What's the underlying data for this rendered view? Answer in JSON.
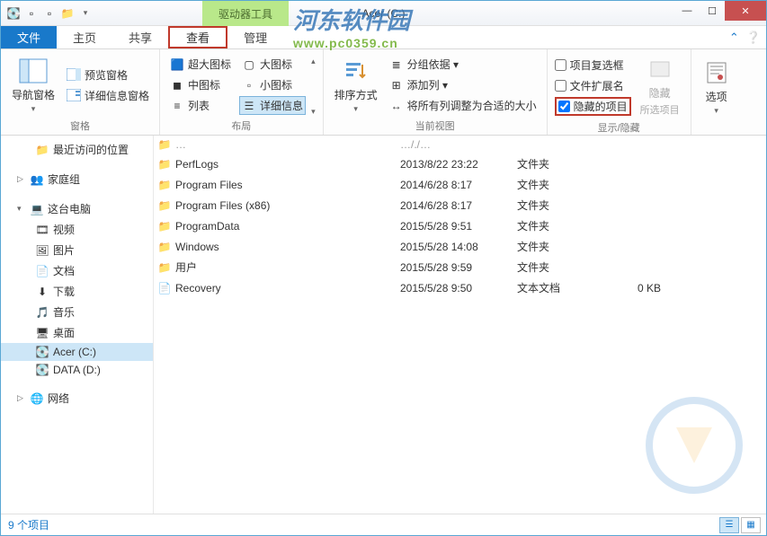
{
  "titlebar": {
    "context_tab": "驱动器工具",
    "title": "Acer (C:)"
  },
  "tabs": {
    "file": "文件",
    "items": [
      "主页",
      "共享",
      "查看",
      "管理"
    ],
    "active_index": 2
  },
  "ribbon": {
    "panes": {
      "nav_pane": "导航窗格",
      "preview_pane": "预览窗格",
      "details_pane": "详细信息窗格",
      "group_label": "窗格"
    },
    "layout": {
      "xl_icons": "超大图标",
      "l_icons": "大图标",
      "m_icons": "中图标",
      "s_icons": "小图标",
      "list": "列表",
      "details": "详细信息",
      "group_label": "布局"
    },
    "currentview": {
      "sort": "排序方式",
      "groupby": "分组依据 ▾",
      "addcol": "添加列 ▾",
      "autosize": "将所有列调整为合适的大小",
      "group_label": "当前视图"
    },
    "showhide": {
      "chk_itemcheckboxes": "项目复选框",
      "chk_extensions": "文件扩展名",
      "chk_hidden": "隐藏的项目",
      "hide_btn": "隐藏",
      "hide_btn_sub": "所选项目",
      "group_label": "显示/隐藏"
    },
    "options": {
      "label": "选项"
    }
  },
  "sidebar": {
    "items": [
      {
        "label": "最近访问的位置",
        "icon": "📁",
        "indent": 1
      },
      {
        "label": "",
        "spacer": true
      },
      {
        "label": "家庭组",
        "icon": "👥",
        "indent": 0,
        "arrow": "▷"
      },
      {
        "label": "",
        "spacer": true
      },
      {
        "label": "这台电脑",
        "icon": "💻",
        "indent": 0,
        "arrow": "▾"
      },
      {
        "label": "视频",
        "icon": "🎞",
        "indent": 1
      },
      {
        "label": "图片",
        "icon": "🖼",
        "indent": 1
      },
      {
        "label": "文档",
        "icon": "📄",
        "indent": 1
      },
      {
        "label": "下载",
        "icon": "⬇",
        "indent": 1
      },
      {
        "label": "音乐",
        "icon": "🎵",
        "indent": 1
      },
      {
        "label": "桌面",
        "icon": "🖥",
        "indent": 1
      },
      {
        "label": "Acer (C:)",
        "icon": "💽",
        "indent": 1,
        "selected": true
      },
      {
        "label": "DATA (D:)",
        "icon": "💽",
        "indent": 1
      },
      {
        "label": "",
        "spacer": true
      },
      {
        "label": "网络",
        "icon": "🌐",
        "indent": 0,
        "arrow": "▷"
      }
    ]
  },
  "files": [
    {
      "name": "PerfLogs",
      "date": "2013/8/22 23:22",
      "type": "文件夹",
      "size": "",
      "icon": "folder"
    },
    {
      "name": "Program Files",
      "date": "2014/6/28 8:17",
      "type": "文件夹",
      "size": "",
      "icon": "folder"
    },
    {
      "name": "Program Files (x86)",
      "date": "2014/6/28 8:17",
      "type": "文件夹",
      "size": "",
      "icon": "folder"
    },
    {
      "name": "ProgramData",
      "date": "2015/5/28 9:51",
      "type": "文件夹",
      "size": "",
      "icon": "folder"
    },
    {
      "name": "Windows",
      "date": "2015/5/28 14:08",
      "type": "文件夹",
      "size": "",
      "icon": "folder"
    },
    {
      "name": "用户",
      "date": "2015/5/28 9:59",
      "type": "文件夹",
      "size": "",
      "icon": "folder"
    },
    {
      "name": "Recovery",
      "date": "2015/5/28 9:50",
      "type": "文本文档",
      "size": "0 KB",
      "icon": "file"
    }
  ],
  "firstrow_date_partial": "…/./…",
  "statusbar": {
    "count": "9 个项目"
  },
  "watermark": {
    "line1": "河东软件园",
    "line2": "www.pc0359.cn"
  }
}
